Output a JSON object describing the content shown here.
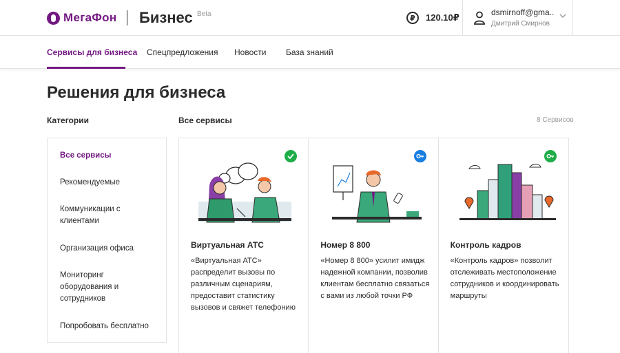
{
  "header": {
    "logo_text": "МегаФон",
    "product": "Бизнес",
    "beta": "Beta",
    "currency_symbol": "₽",
    "balance": "120.10₽",
    "user_email": "dsmirnoff@gma...",
    "user_name": "Дмитрий Смирнов"
  },
  "nav": {
    "items": [
      "Сервисы для бизнеса",
      "Спецпредложения",
      "Новости",
      "База знаний"
    ]
  },
  "page_title": "Решения для бизнеса",
  "categories_label": "Категории",
  "services_label": "Все сервисы",
  "services_count": "8 Сервисов",
  "sidebar": {
    "items": [
      "Все сервисы",
      "Рекомендуемые",
      "Коммуникации с клиентами",
      "Организация офиса",
      "Мониторинг оборудования и сотрудников",
      "Попробовать бесплатно"
    ]
  },
  "cards": [
    {
      "title": "Виртуальная АТС",
      "desc": "«Виртуальная АТС» распределит вызовы по различным сценариям, предоставит статистику вызовов и свяжет телефонию",
      "badge": "check-icon",
      "badge_color": "#1fad48"
    },
    {
      "title": "Номер 8 800",
      "desc": "«Номер 8 800» усилит имидж надежной компании, позволив клиентам бесплатно связаться с вами из любой точки РФ",
      "badge": "key-icon",
      "badge_color": "#1a7ee0"
    },
    {
      "title": "Контроль кадров",
      "desc": "«Контроль кадров» позволит отслеживать местоположение сотрудников и координировать маршруты",
      "badge": "key-icon",
      "badge_color": "#1fad48"
    }
  ],
  "colors": {
    "brand": "#731982",
    "accent_green": "#1fad48",
    "accent_blue": "#1a7ee0"
  }
}
